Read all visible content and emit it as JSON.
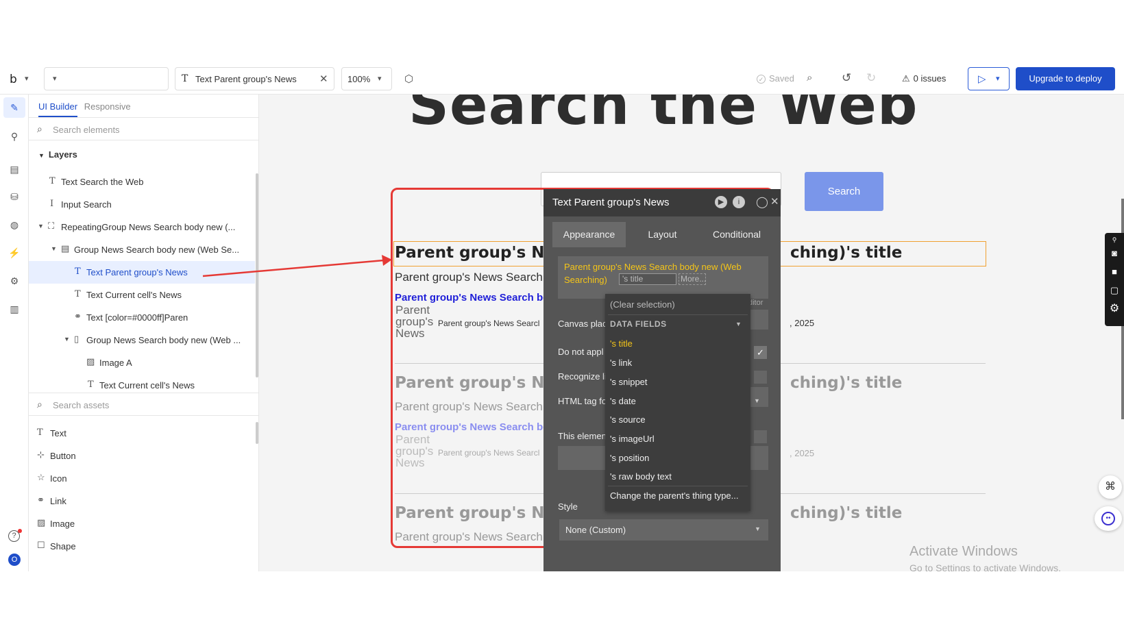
{
  "topbar": {
    "logo": "b",
    "page_select_value": "",
    "element_select_label": "Text Parent group's News",
    "zoom": "100%",
    "saved_label": "Saved",
    "issues_label": "0 issues",
    "deploy_label": "Upgrade to deploy"
  },
  "left_panel": {
    "tab_active": "UI Builder",
    "tab_other": "Responsive",
    "search_elements_placeholder": "Search elements",
    "layers_header": "Layers",
    "layers": [
      {
        "label": "Text Search the Web",
        "icon": "T"
      },
      {
        "label": "Input Search",
        "icon": "I"
      },
      {
        "label": "RepeatingGroup News Search body new (...",
        "icon": "repeating-group-icon"
      },
      {
        "label": "Group News Search body new (Web Se...",
        "icon": "group-icon"
      },
      {
        "label": "Text Parent group's News",
        "icon": "T",
        "selected": true
      },
      {
        "label": "Text Current cell's News",
        "icon": "T"
      },
      {
        "label": "Text [color=#0000ff]Paren",
        "icon": "link-icon"
      },
      {
        "label": "Group News Search body new (Web ...",
        "icon": "column-group-icon"
      },
      {
        "label": "Image A",
        "icon": "image-icon"
      },
      {
        "label": "Text Current cell's News",
        "icon": "T"
      }
    ],
    "search_assets_placeholder": "Search assets",
    "assets": [
      "Text",
      "Button",
      "Icon",
      "Link",
      "Image",
      "Shape"
    ],
    "avatar_initial": "O"
  },
  "canvas": {
    "heading": "Search the Web",
    "search_button": "Search",
    "row_title_left": "Parent group's Nev",
    "row_title_right": "ching)'s title",
    "row_sub": "Parent group's News Search",
    "row_link": "Parent group's News Search bod",
    "row_img_alt": "Parent group's News",
    "row_small": "Parent group's News Searcl",
    "row_date": ", 2025"
  },
  "property_editor": {
    "title": "Text Parent group's News",
    "tabs": [
      "Appearance",
      "Layout",
      "Conditional"
    ],
    "expression": "Parent group's News Search body new (Web Searching)",
    "expression_chip": "'s title",
    "expression_more": "More...",
    "editor_label": "ditor",
    "labels": {
      "canvas_placeholder": "Canvas plac",
      "do_not_apply": "Do not appl",
      "recognize": "Recognize li",
      "html_tag": "HTML tag fo",
      "this_element": "This elemen",
      "style": "Style"
    },
    "style_value": "None (Custom)"
  },
  "dropdown": {
    "clear": "(Clear selection)",
    "header": "DATA FIELDS",
    "options": [
      "'s title",
      "'s link",
      "'s snippet",
      "'s date",
      "'s source",
      "'s imageUrl",
      "'s position",
      "'s raw body text"
    ],
    "change_type": "Change the parent's thing type..."
  },
  "watermark": {
    "line1": "Activate Windows",
    "line2": "Go to Settings to activate Windows."
  },
  "colors": {
    "accent": "#1f4ec9",
    "selection_red": "#e53935",
    "expression_yellow": "#f5c518",
    "search_button": "#7a96ea"
  }
}
